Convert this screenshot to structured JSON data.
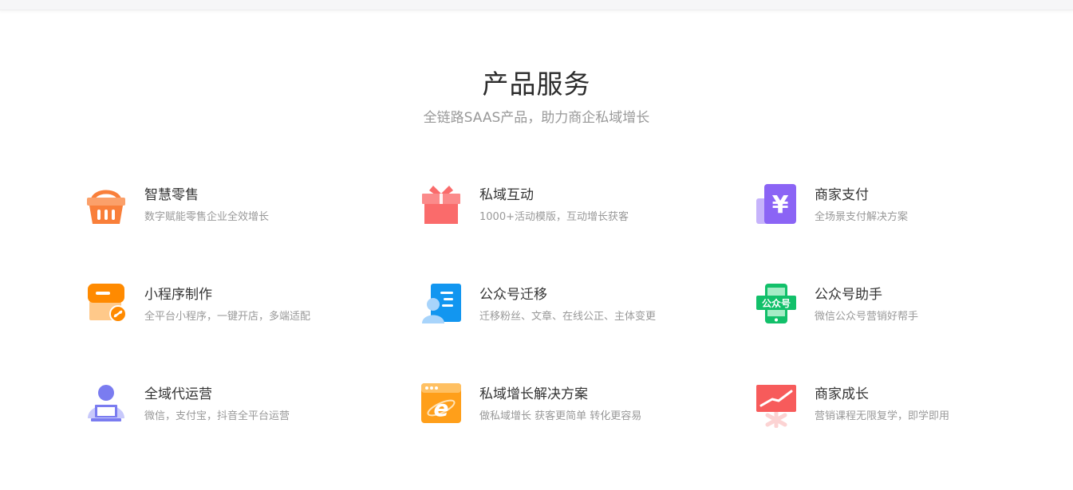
{
  "section": {
    "title": "产品服务",
    "subtitle": "全链路SAAS产品，助力商企私域增长"
  },
  "products": [
    {
      "title": "智慧零售",
      "desc": "数字赋能零售企业全效增长",
      "icon": "shopping-basket-icon",
      "color": "#f97f3a"
    },
    {
      "title": "私域互动",
      "desc": "1000+活动模版，互动增长获客",
      "icon": "gift-box-icon",
      "color": "#fa6b6b"
    },
    {
      "title": "商家支付",
      "desc": "全场景支付解决方案",
      "icon": "yuan-payment-icon",
      "color": "#8b64f5"
    },
    {
      "title": "小程序制作",
      "desc": "全平台小程序，一键开店，多端适配",
      "icon": "mini-program-store-icon",
      "color": "#ff8a00"
    },
    {
      "title": "公众号迁移",
      "desc": "迁移粉丝、文章、在线公正、主体变更",
      "icon": "account-migration-icon",
      "color": "#1296f0"
    },
    {
      "title": "公众号助手",
      "desc": "微信公众号营销好帮手",
      "icon": "official-account-phone-icon",
      "color": "#12c06a"
    },
    {
      "title": "全域代运营",
      "desc": "微信，支付宝，抖音全平台运营",
      "icon": "operator-laptop-icon",
      "color": "#7a7cf0"
    },
    {
      "title": "私域增长解决方案",
      "desc": "做私域增长 获客更简单 转化更容易",
      "icon": "browser-e-icon",
      "color": "#ff9f1a"
    },
    {
      "title": "商家成长",
      "desc": "营销课程无限复学，即学即用",
      "icon": "growth-chart-icon",
      "color": "#f75b5b"
    }
  ],
  "icon_text": {
    "yuan_symbol": "¥",
    "official_account_badge": "公众号",
    "browser_letter": "e"
  }
}
